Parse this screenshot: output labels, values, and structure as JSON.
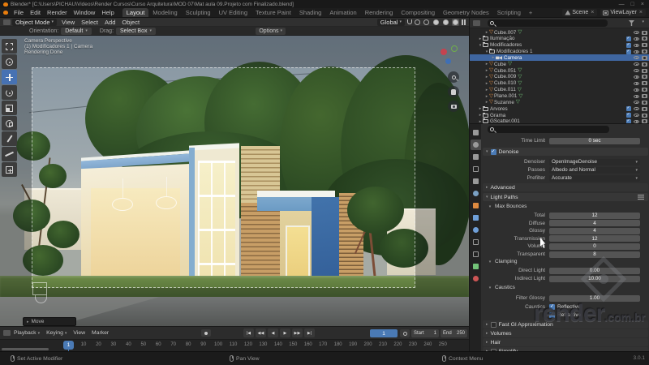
{
  "app": {
    "title": "Blender* [C:\\Users\\PICHAU\\Videos\\Render Cursos\\Curso Arquitetura\\MOD 07\\Mat aula 09.Projeto com Finalizado.blend]",
    "version": "3.0.1",
    "window_controls": {
      "minimize": "—",
      "maximize": "□",
      "close": "×"
    }
  },
  "menu_bar": {
    "menus": [
      "File",
      "Edit",
      "Render",
      "Window",
      "Help"
    ],
    "workspaces": [
      "Layout",
      "Modeling",
      "Sculpting",
      "UV Editing",
      "Texture Paint",
      "Shading",
      "Animation",
      "Rendering",
      "Compositing",
      "Geometry Nodes",
      "Scripting"
    ],
    "active_workspace": "Layout",
    "new_workspace_label": "+",
    "scene_name": "Scene",
    "view_layer_name": "ViewLayer"
  },
  "viewport_header": {
    "mode": "Object Mode",
    "menus": [
      "View",
      "Select",
      "Add",
      "Object"
    ],
    "orientation": "Global",
    "options_label": "Options"
  },
  "tool_settings": {
    "orientation_label": "Orientation:",
    "orientation_value": "Default",
    "drag_label": "Drag:",
    "drag_value": "Select Box"
  },
  "viewport": {
    "overlay_lines": [
      "Camera Perspective",
      "(1) Modificadores 1 | Camera",
      "Rendering Done"
    ],
    "operator_panel_label": "Move",
    "tools": [
      "select-box",
      "cursor",
      "move",
      "rotate",
      "scale",
      "transform",
      "annotate",
      "measure",
      "add-cube"
    ],
    "active_tool": "move"
  },
  "outliner": {
    "rows": [
      {
        "label": "Cube.007",
        "type": "mesh",
        "depth": 2
      },
      {
        "label": "Iluminação",
        "type": "collection",
        "depth": 1,
        "open": false
      },
      {
        "label": "Modificadores",
        "type": "collection",
        "depth": 1,
        "open": true
      },
      {
        "label": "Modificadores 1",
        "type": "collection",
        "depth": 2,
        "open": true
      },
      {
        "label": "Camera",
        "type": "camera",
        "depth": 3,
        "selected": true
      },
      {
        "label": "Cube",
        "type": "mesh",
        "depth": 2
      },
      {
        "label": "Cube.051",
        "type": "mesh",
        "depth": 2
      },
      {
        "label": "Cube.009",
        "type": "mesh",
        "depth": 2
      },
      {
        "label": "Cube.010",
        "type": "mesh",
        "depth": 2
      },
      {
        "label": "Cube.011",
        "type": "mesh",
        "depth": 2
      },
      {
        "label": "Plane.001",
        "type": "mesh",
        "depth": 2
      },
      {
        "label": "Suzanne",
        "type": "mesh",
        "depth": 2
      },
      {
        "label": "Arvores",
        "type": "collection",
        "depth": 1,
        "open": false
      },
      {
        "label": "Grama",
        "type": "collection",
        "depth": 1,
        "open": false
      },
      {
        "label": "GScatter.001",
        "type": "collection",
        "depth": 1,
        "open": false
      }
    ]
  },
  "properties": {
    "tabs": [
      "tool",
      "render",
      "output",
      "view-layer",
      "scene",
      "world",
      "object",
      "modifiers",
      "particles",
      "physics",
      "constraints",
      "object-data",
      "material"
    ],
    "active_tab": "render",
    "time_limit": {
      "label": "Time Limit",
      "value": "0 sec"
    },
    "denoise": {
      "title": "Denoise",
      "checked": true,
      "rows": [
        {
          "label": "Denoiser",
          "value": "OpenImageDenoise"
        },
        {
          "label": "Passes",
          "value": "Albedo and Normal"
        },
        {
          "label": "Prefilter",
          "value": "Accurate"
        }
      ]
    },
    "advanced_title": "Advanced",
    "light_paths_title": "Light Paths",
    "max_bounces": {
      "title": "Max Bounces",
      "rows": [
        {
          "label": "Total",
          "value": "12"
        },
        {
          "label": "Diffuse",
          "value": "4"
        },
        {
          "label": "Glossy",
          "value": "4"
        },
        {
          "label": "Transmission",
          "value": "12"
        },
        {
          "label": "Volume",
          "value": "0"
        },
        {
          "label": "Transparent",
          "value": "8"
        }
      ]
    },
    "clamping": {
      "title": "Clamping",
      "rows": [
        {
          "label": "Direct Light",
          "value": "0.00"
        },
        {
          "label": "Indirect Light",
          "value": "10.00"
        }
      ]
    },
    "caustics": {
      "title": "Caustics",
      "filter_glossy": {
        "label": "Filter Glossy",
        "value": "1.00"
      },
      "group_label": "Caustics",
      "options": [
        {
          "label": "Reflective",
          "checked": true
        },
        {
          "label": "Refractive",
          "checked": true
        }
      ]
    },
    "collapsed_sections": [
      {
        "title": "Fast GI Approximation",
        "checkbox": true
      },
      {
        "title": "Volumes",
        "checkbox": false
      },
      {
        "title": "Hair",
        "checkbox": false
      },
      {
        "title": "Simplify",
        "checkbox": true
      }
    ]
  },
  "timeline": {
    "menus": [
      "Playback",
      "Keying",
      "View",
      "Marker"
    ],
    "transport": [
      "|◀",
      "◀◀",
      "◀",
      "▶",
      "▶▶",
      "▶|"
    ],
    "current_frame": "1",
    "start_label": "Start",
    "start_value": "1",
    "end_label": "End",
    "end_value": "250",
    "playhead_label": "1",
    "ticks": [
      10,
      20,
      30,
      40,
      50,
      60,
      70,
      80,
      90,
      100,
      110,
      120,
      130,
      140,
      150,
      160,
      170,
      180,
      190,
      200,
      210,
      220,
      230,
      240,
      250
    ]
  },
  "status_bar": {
    "items": [
      "Set Active Modifier",
      "Pan View",
      "Context Menu"
    ]
  },
  "watermark": {
    "text": "render",
    "suffix": "com.br"
  },
  "colors": {
    "accent": "#4772b3",
    "blue_trim": "#7fa9cf",
    "wall_cream": "#efe8d2",
    "wood": "#c89e66",
    "sky": "#8494a2"
  }
}
